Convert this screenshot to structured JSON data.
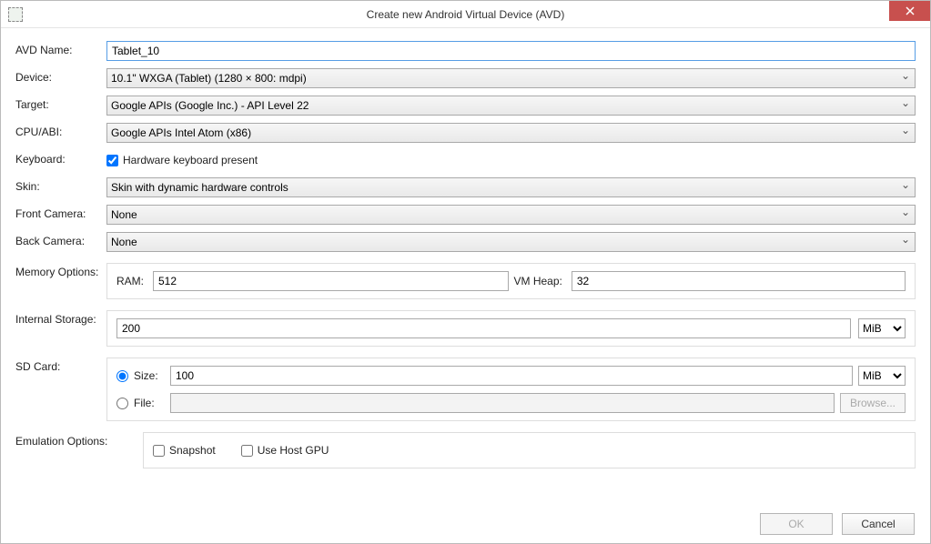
{
  "window": {
    "title": "Create new Android Virtual Device (AVD)"
  },
  "labels": {
    "avd_name": "AVD Name:",
    "device": "Device:",
    "target": "Target:",
    "cpu_abi": "CPU/ABI:",
    "keyboard": "Keyboard:",
    "skin": "Skin:",
    "front_camera": "Front Camera:",
    "back_camera": "Back Camera:",
    "memory_options": "Memory Options:",
    "internal_storage": "Internal Storage:",
    "sd_card": "SD Card:",
    "emulation_options": "Emulation Options:",
    "ram": "RAM:",
    "vm_heap": "VM Heap:",
    "size": "Size:",
    "file": "File:",
    "keyboard_checkbox": "Hardware keyboard present",
    "snapshot": "Snapshot",
    "use_host_gpu": "Use Host GPU",
    "browse": "Browse...",
    "ok": "OK",
    "cancel": "Cancel"
  },
  "values": {
    "avd_name": "Tablet_10",
    "device": "10.1\" WXGA (Tablet) (1280 × 800: mdpi)",
    "target": "Google APIs (Google Inc.) - API Level 22",
    "cpu_abi": "Google APIs Intel Atom (x86)",
    "keyboard_checked": true,
    "skin": "Skin with dynamic hardware controls",
    "front_camera": "None",
    "back_camera": "None",
    "ram": "512",
    "vm_heap": "32",
    "internal_storage": "200",
    "internal_storage_unit": "MiB",
    "sd_card_mode": "size",
    "sd_size": "100",
    "sd_unit": "MiB",
    "sd_file": "",
    "snapshot_checked": false,
    "use_host_gpu_checked": false
  }
}
